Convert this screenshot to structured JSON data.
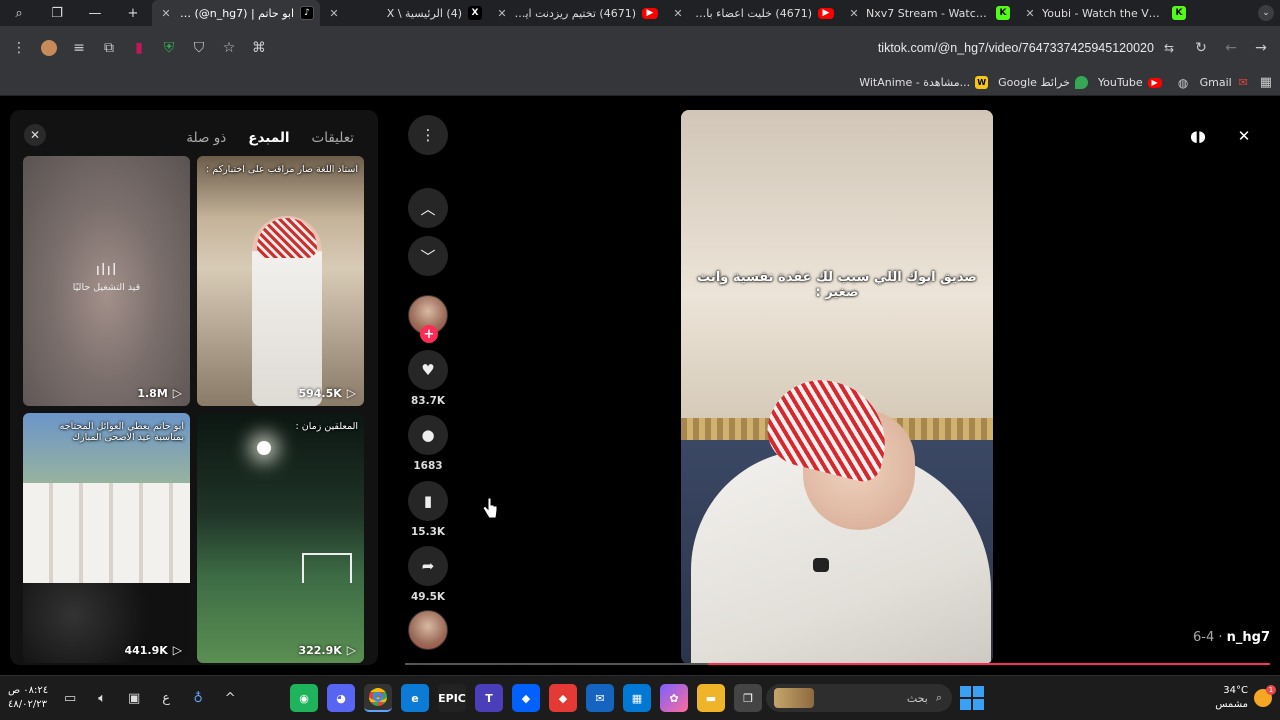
{
  "browser": {
    "tabs": [
      {
        "title": "Youbi - Watch the VOD on",
        "favicon": "kick-icon",
        "active": false
      },
      {
        "title": "Nxv7 Stream - Watch Live",
        "favicon": "kick-icon",
        "active": false
      },
      {
        "title": "(4671) خليت اعضاء باور يجر",
        "favicon": "youtube-icon",
        "active": false
      },
      {
        "title": "(4671) تختيم ريزدنت ايفل 7",
        "favicon": "youtube-icon",
        "active": false
      },
      {
        "title": "(4) الرئيسية \\ X",
        "favicon": "x-icon",
        "active": false
      },
      {
        "title": "ابو حاتم | TikTok (@n_hg7)",
        "favicon": "tiktok-icon",
        "active": true
      }
    ],
    "url": "tiktok.com/@n_hg7/video/7647337425945120020",
    "bookmarks": [
      {
        "label": "Gmail",
        "icon": "gmail-icon"
      },
      {
        "label": "YouTube",
        "icon": "youtube-icon"
      },
      {
        "label": "Google خرائط",
        "icon": "maps-icon"
      },
      {
        "label": "WitAnime - مشاهدة...",
        "icon": "witanime-icon"
      }
    ]
  },
  "panel": {
    "tabs": [
      "تعليقات",
      "المبدع",
      "ذو صلة"
    ],
    "active_tab": "المبدع",
    "videos": [
      {
        "views": "594.5K",
        "caption": "استاذ اللغة صار مراقب على اختباركم :",
        "center_text": ""
      },
      {
        "views": "1.8M",
        "caption": "",
        "center_text": "قيد التشغيل حاليًا"
      },
      {
        "views": "322.9K",
        "caption": "المعلقين زمان :",
        "center_text": ""
      },
      {
        "views": "441.9K",
        "caption": "ابو حاتم يعطي العوائل المحتاجه بمناسبة عيد الاضحى المبارك",
        "center_text": ""
      }
    ]
  },
  "rail": {
    "likes": "83.7K",
    "comments": "1683",
    "saves": "15.3K",
    "shares": "49.5K"
  },
  "video": {
    "caption": "صديق ابوك اللي سبب لك عقدة نفسية وانت صغير :",
    "author": "n_hg7",
    "meta": "6-4 · ",
    "progress": 0.35
  },
  "taskbar": {
    "time": "٠٨:٢٤ ص",
    "date": "٤٨/٠٢/٢٣",
    "lang": "ع",
    "search_placeholder": "بحث",
    "temperature": "34°C",
    "weather_text": "مشمس"
  },
  "colors": {
    "accent": "#fe2c55",
    "background": "#000000",
    "panel": "#121212"
  }
}
